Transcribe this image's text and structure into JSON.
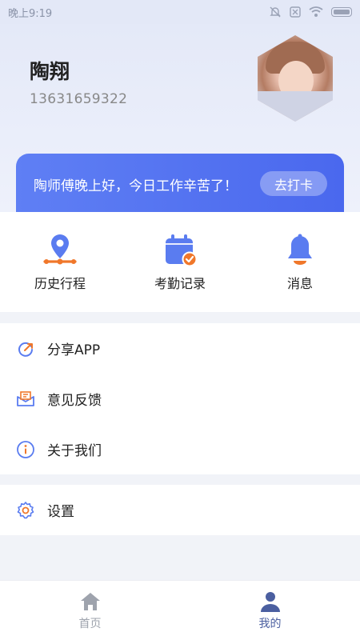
{
  "status_bar": {
    "time": "晚上9:19"
  },
  "profile": {
    "name": "陶翔",
    "phone": "13631659322"
  },
  "banner": {
    "greeting": "陶师傅晚上好，今日工作辛苦了！",
    "button_label": "去打卡"
  },
  "quick_actions": [
    {
      "label": "历史行程",
      "icon": "location-pin-route-icon"
    },
    {
      "label": "考勤记录",
      "icon": "calendar-check-icon"
    },
    {
      "label": "消息",
      "icon": "bell-icon"
    }
  ],
  "menu": {
    "group1": [
      {
        "label": "分享APP",
        "icon": "share-refresh-icon"
      },
      {
        "label": "意见反馈",
        "icon": "mail-feedback-icon"
      },
      {
        "label": "关于我们",
        "icon": "info-icon"
      }
    ],
    "group2": [
      {
        "label": "设置",
        "icon": "gear-icon"
      }
    ]
  },
  "tabs": [
    {
      "label": "首页",
      "icon": "home-icon",
      "active": false
    },
    {
      "label": "我的",
      "icon": "user-icon",
      "active": true
    }
  ],
  "colors": {
    "primary": "#4a68ee",
    "accent_orange": "#f0772a",
    "tab_inactive": "#9ea3ad",
    "tab_active": "#4b5fa0"
  }
}
